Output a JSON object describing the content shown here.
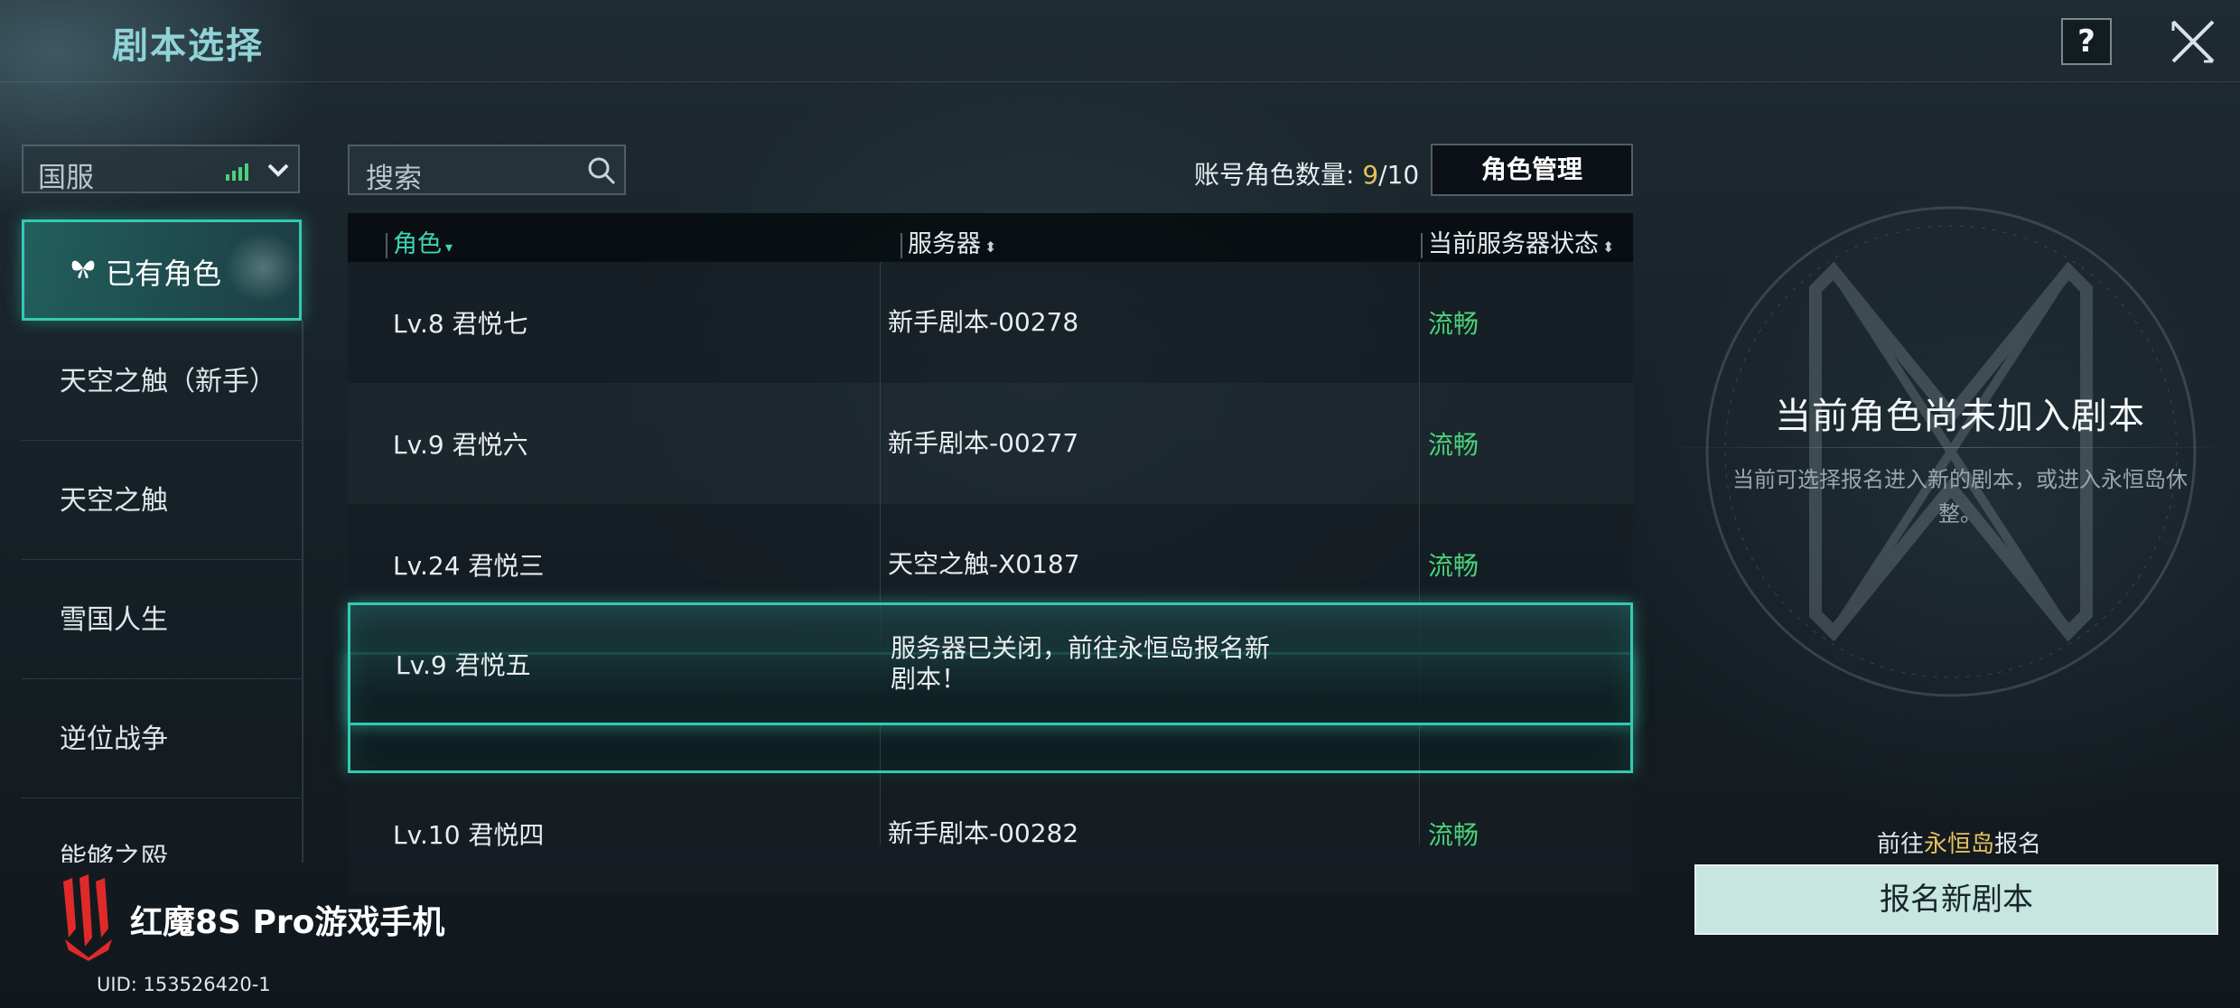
{
  "header": {
    "title": "剧本选择",
    "help_label": "?"
  },
  "server": {
    "name": "国服"
  },
  "categories": {
    "active": "已有角色",
    "items": [
      "天空之触（新手）",
      "天空之触",
      "雪国人生",
      "逆位战争",
      "能够之殴"
    ]
  },
  "search": {
    "placeholder": "搜索"
  },
  "account": {
    "role_count_label": "账号角色数量:",
    "current": "9",
    "sep": "/",
    "max": "10",
    "manage_button": "角色管理"
  },
  "table": {
    "headers": {
      "role": "角色",
      "server": "服务器",
      "status": "当前服务器状态"
    },
    "rows": [
      {
        "role": "Lv.8 君悦七",
        "server": "新手剧本-00278",
        "status": "流畅"
      },
      {
        "role": "Lv.9 君悦六",
        "server": "新手剧本-00277",
        "status": "流畅"
      },
      {
        "role": "Lv.24 君悦三",
        "server": "天空之触-X0187",
        "status": "流畅"
      },
      {
        "role": "Lv.9 君悦五",
        "server": "服务器已关闭，前往永恒岛报名新剧本！",
        "status": ""
      },
      {
        "role": "Lv.10 君悦四",
        "server": "新手剧本-00282",
        "status": "流畅"
      }
    ]
  },
  "right_panel": {
    "title": "当前角色尚未加入剧本",
    "description": "当前可选择报名进入新的剧本，或进入永恒岛休整。",
    "goto_prefix": "前往",
    "goto_place": "永恒岛",
    "goto_suffix": "报名",
    "signup_button": "报名新剧本"
  },
  "watermark": {
    "brand": "红魔8S Pro游戏手机",
    "uid": "UID: 153526420-1"
  },
  "colors": {
    "accent": "#35c9b1",
    "status_ok": "#48d37a",
    "gold": "#e6c05e",
    "title": "#8fd3d7"
  }
}
